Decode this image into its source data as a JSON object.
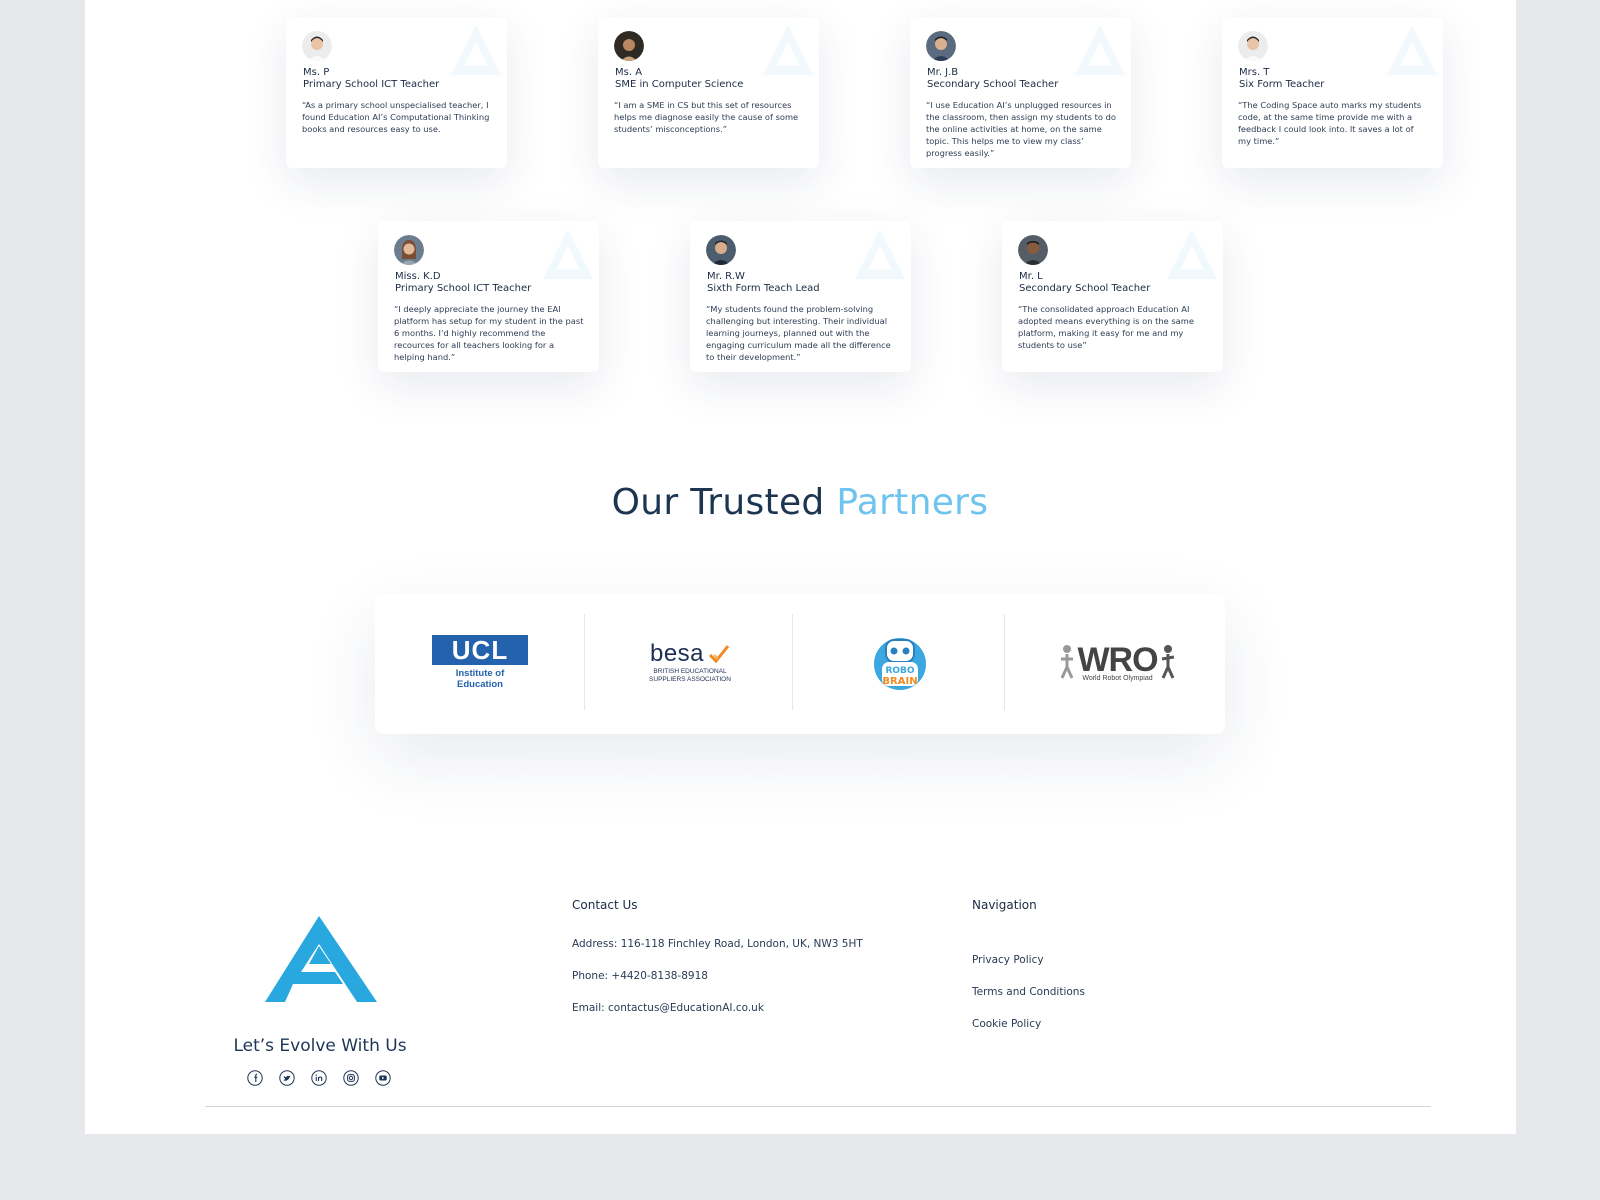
{
  "testimonials": [
    {
      "name": "Ms. P",
      "role": "Primary School ICT Teacher",
      "quote": "“As a primary school unspecialised teacher, I found Education AI’s Computational Thinking books and resources easy to use."
    },
    {
      "name": "Ms. A",
      "role": "SME in Computer Science",
      "quote": "“I am a SME in CS but this set of resources helps me diagnose easily the cause of some students’ misconceptions.”"
    },
    {
      "name": "Mr. J.B",
      "role": "Secondary School Teacher",
      "quote": "“I use Education AI’s unplugged resources in the classroom, then assign my students to do the online activities at home, on the same topic. This helps me to view my class’ progress easily.”"
    },
    {
      "name": "Mrs. T",
      "role": "Six Form Teacher",
      "quote": "“The Coding Space auto marks my students code, at the same time provide me with a feedback I could look into. It saves a lot of my time.”"
    },
    {
      "name": "Miss. K.D",
      "role": "Primary School ICT Teacher",
      "quote": "“I deeply appreciate the journey the EAI platform has setup for my student in the past 6 months. I’d highly recommend the recources for all teachers looking for a helping hand.”"
    },
    {
      "name": "Mr. R.W",
      "role": "Sixth Form Teach Lead",
      "quote": "“My students found the problem-solving challenging but interesting. Their individual learning journeys, planned out with the engaging curriculum made all the difference to their development.”"
    },
    {
      "name": "Mr. L",
      "role": "Secondary School Teacher",
      "quote": "“The consolidated approach Education AI adopted means everything is on the same platform, making it easy for me and my students to use”"
    }
  ],
  "partners": {
    "title_main": "Our Trusted",
    "title_accent": "Partners",
    "accent_color": "#6ec3ef",
    "logos": [
      {
        "mark": "UCL",
        "sub": "Institute of Education"
      },
      {
        "mark": "besa",
        "sub1": "BRITISH EDUCATIONAL",
        "sub2": "SUPPLIERS ASSOCIATION"
      },
      {
        "mark1": "ROBO",
        "mark2": "BRAIN"
      },
      {
        "mark": "WRO",
        "sub": "World Robot Olympiad"
      }
    ]
  },
  "footer": {
    "tagline": "Let’s Evolve With Us",
    "brand_color": "#29a8e0",
    "contact": {
      "title": "Contact Us",
      "address": "Address: 116-118 Finchley Road, London, UK, NW3 5HT",
      "phone": "Phone: +4420-8138-8918",
      "email": "Email: contactus@EducationAI.co.uk"
    },
    "navigation": {
      "title": "Navigation",
      "links": [
        "Privacy Policy",
        "Terms and Conditions",
        "Cookie Policy"
      ]
    },
    "social_icons": [
      "facebook-icon",
      "twitter-icon",
      "linkedin-icon",
      "instagram-icon",
      "youtube-icon"
    ]
  }
}
